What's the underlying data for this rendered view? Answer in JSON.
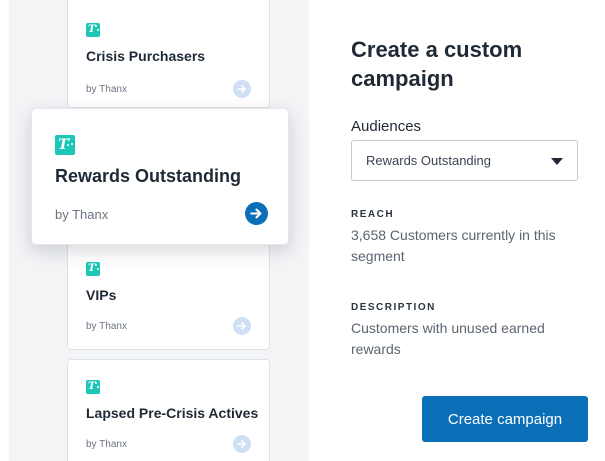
{
  "campaign_cards": [
    {
      "title": "Crisis Purchasers",
      "byline": "by Thanx"
    },
    {
      "title": "Rewards Outstanding",
      "byline": "by Thanx"
    },
    {
      "title": "VIPs",
      "byline": "by Thanx"
    },
    {
      "title": "Lapsed Pre-Crisis Actives",
      "byline": "by Thanx"
    }
  ],
  "panel": {
    "heading": "Create a custom campaign",
    "audiences_label": "Audiences",
    "audiences_selected": "Rewards Outstanding",
    "reach_label": "REACH",
    "reach_text": "3,658 Customers currently in this segment",
    "description_label": "DESCRIPTION",
    "description_text": "Customers with unused earned rewards",
    "cta_label": "Create campaign"
  },
  "colors": {
    "brand_teal": "#1cc7b7",
    "primary_blue": "#0b6fb8",
    "arrow_inactive": "#cfe0f4"
  },
  "icons": {
    "card_logo": "thanx-logo-icon",
    "card_arrow": "arrow-right-circle-icon",
    "select_caret": "caret-down-icon"
  }
}
